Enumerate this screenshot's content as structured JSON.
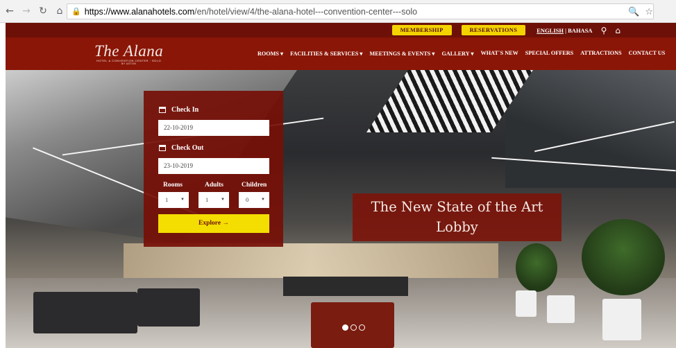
{
  "browser": {
    "url_host": "https://www.alanahotels.com",
    "url_path": "/en/hotel/view/4/the-alana-hotel---convention-center---solo"
  },
  "topbar": {
    "membership": "MEMBERSHIP",
    "reservations": "RESERVATIONS",
    "lang_english": "ENGLISH",
    "lang_sep": " | ",
    "lang_bahasa": "BAHASA"
  },
  "logo": {
    "name": "The Alana",
    "sub": "HOTEL & CONVENTION CENTER · SOLO",
    "sub2": "BY ASTON"
  },
  "nav": {
    "items": [
      "ROOMS ▾",
      "FACILITIES & SERVICES ▾",
      "MEETINGS & EVENTS ▾",
      "GALLERY ▾",
      "WHAT`S NEW",
      "SPECIAL OFFERS",
      "ATTRACTIONS",
      "CONTACT US"
    ]
  },
  "booking": {
    "check_in_label": "Check In",
    "check_in_value": "22-10-2019",
    "check_out_label": "Check Out",
    "check_out_value": "23-10-2019",
    "rooms_label": "Rooms",
    "adults_label": "Adults",
    "children_label": "Children",
    "rooms_value": "1",
    "adults_value": "1",
    "children_value": "0",
    "explore_label": "Explore →"
  },
  "hero": {
    "caption": "The New State of the Art Lobby",
    "slide_count": 3,
    "active_slide": 1
  },
  "colors": {
    "brand_dark": "#6d1008",
    "brand": "#8a1607",
    "accent_yellow": "#f4d400"
  }
}
